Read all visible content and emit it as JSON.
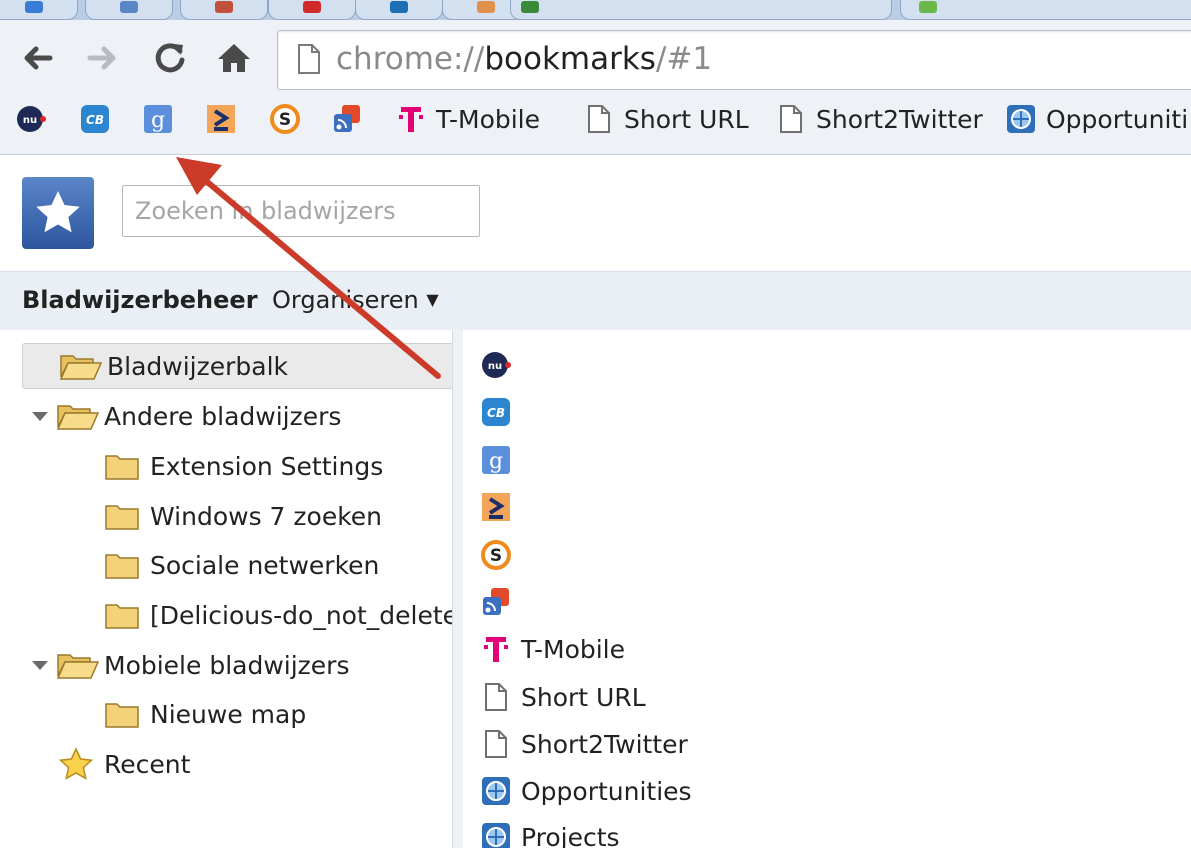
{
  "browser": {
    "address_bar": {
      "scheme": "chrome://",
      "host": "bookmarks",
      "path": "/#1"
    },
    "nav": {
      "back_icon": "arrow-left-icon",
      "forward_icon": "arrow-right-icon",
      "reload_icon": "reload-icon",
      "home_icon": "home-icon"
    }
  },
  "bookmarks_bar": {
    "icon_items": [
      "nu-icon",
      "cb-icon",
      "google-icon",
      "orange-arrow-icon",
      "s-circle-icon",
      "feed-icon"
    ],
    "labeled_items": [
      {
        "label": "T-Mobile",
        "icon": "t-mobile-icon"
      },
      {
        "label": "Short URL",
        "icon": "page-icon"
      },
      {
        "label": "Short2Twitter",
        "icon": "page-icon"
      },
      {
        "label": "Opportuniti",
        "icon": "globe-icon"
      }
    ]
  },
  "header": {
    "search_placeholder": "Zoeken in bladwijzers"
  },
  "subbar": {
    "title": "Bladwijzerbeheer",
    "organize": "Organiseren"
  },
  "tree": [
    {
      "label": "Bladwijzerbalk",
      "icon": "folder-open-icon",
      "selected": true
    },
    {
      "label": "Andere bladwijzers",
      "icon": "folder-open-icon",
      "expanded": true
    },
    {
      "label": "Extension Settings",
      "icon": "folder-icon"
    },
    {
      "label": "Windows 7 zoeken",
      "icon": "folder-icon"
    },
    {
      "label": "Sociale netwerken",
      "icon": "folder-icon"
    },
    {
      "label": "[Delicious-do_not_delete]",
      "icon": "folder-icon"
    },
    {
      "label": "Mobiele bladwijzers",
      "icon": "folder-open-icon",
      "expanded": true
    },
    {
      "label": "Nieuwe map",
      "icon": "folder-icon"
    },
    {
      "label": "Recent",
      "icon": "star-icon"
    }
  ],
  "list": [
    {
      "label": "",
      "icon": "nu-icon"
    },
    {
      "label": "",
      "icon": "cb-icon"
    },
    {
      "label": "",
      "icon": "google-icon"
    },
    {
      "label": "",
      "icon": "orange-arrow-icon"
    },
    {
      "label": "",
      "icon": "s-circle-icon"
    },
    {
      "label": "",
      "icon": "feed-icon"
    },
    {
      "label": "T-Mobile",
      "icon": "t-mobile-icon"
    },
    {
      "label": "Short URL",
      "icon": "page-icon"
    },
    {
      "label": "Short2Twitter",
      "icon": "page-icon"
    },
    {
      "label": "Opportunities",
      "icon": "globe-icon"
    },
    {
      "label": "Projects",
      "icon": "globe-icon"
    }
  ],
  "colors": {
    "accent_arrow": "#cc3a2a",
    "logo_blue": "#3a64ad",
    "subbar_bg": "#eaeff6"
  }
}
